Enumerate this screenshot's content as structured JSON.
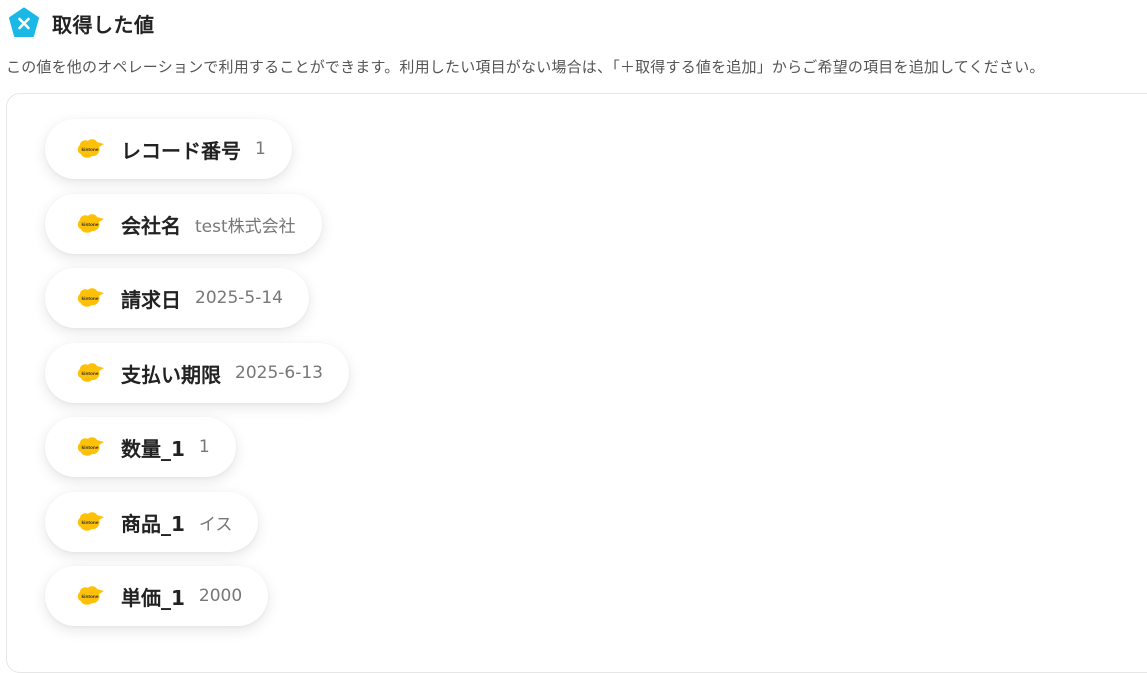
{
  "header": {
    "title": "取得した値",
    "icon": "x-pentagon-icon",
    "icon_color": "#1ab8e6"
  },
  "description": "この値を他のオペレーションで利用することができます。利用したい項目がない場合は、「＋取得する値を追加」からご希望の項目を追加してください。",
  "fields": [
    {
      "label": "レコード番号",
      "value": "1",
      "icon": "kintone-icon"
    },
    {
      "label": "会社名",
      "value": "test株式会社",
      "icon": "kintone-icon"
    },
    {
      "label": "請求日",
      "value": "2025-5-14",
      "icon": "kintone-icon"
    },
    {
      "label": "支払い期限",
      "value": "2025-6-13",
      "icon": "kintone-icon"
    },
    {
      "label": "数量_1",
      "value": "1",
      "icon": "kintone-icon"
    },
    {
      "label": "商品_1",
      "value": "イス",
      "icon": "kintone-icon"
    },
    {
      "label": "単価_1",
      "value": "2000",
      "icon": "kintone-icon"
    }
  ],
  "kintone_icon_text": "kintone",
  "colors": {
    "kintone_yellow": "#ffc107",
    "accent": "#1ab8e6"
  }
}
